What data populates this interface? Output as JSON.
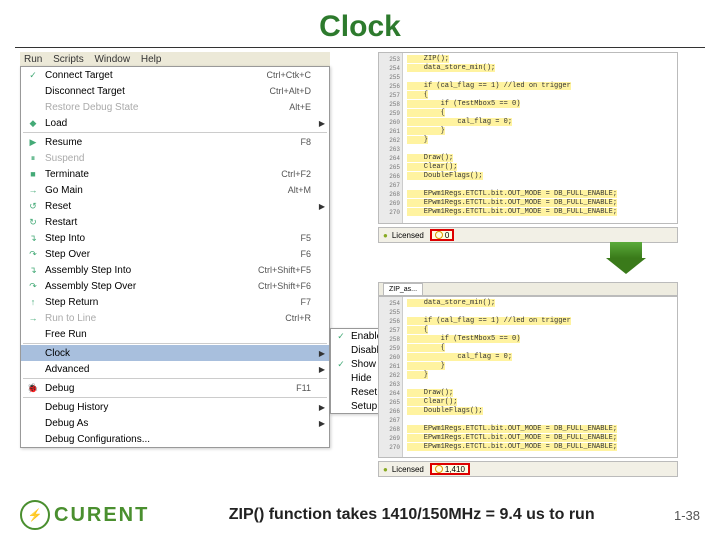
{
  "title": "Clock",
  "menubar": {
    "items": [
      "Run",
      "Scripts",
      "Window",
      "Help"
    ]
  },
  "menu": {
    "items": [
      {
        "icon": "✓",
        "label": "Connect Target",
        "shortcut": "Ctrl+Ctk+C",
        "arrow": false
      },
      {
        "icon": "",
        "label": "Disconnect Target",
        "shortcut": "Ctrl+Alt+D",
        "arrow": false
      },
      {
        "icon": "",
        "label": "Restore Debug State",
        "shortcut": "Alt+E",
        "arrow": false,
        "disabled": true
      },
      {
        "icon": "◆",
        "label": "Load",
        "shortcut": "",
        "arrow": true
      },
      {
        "sep": true
      },
      {
        "icon": "▶",
        "label": "Resume",
        "shortcut": "F8",
        "arrow": false
      },
      {
        "icon": "⏸",
        "label": "Suspend",
        "shortcut": "",
        "arrow": false,
        "disabled": true
      },
      {
        "icon": "■",
        "label": "Terminate",
        "shortcut": "Ctrl+F2",
        "arrow": false
      },
      {
        "icon": "→",
        "label": "Go Main",
        "shortcut": "Alt+M",
        "arrow": false
      },
      {
        "icon": "↺",
        "label": "Reset",
        "shortcut": "",
        "arrow": true
      },
      {
        "icon": "↻",
        "label": "Restart",
        "shortcut": "",
        "arrow": false
      },
      {
        "icon": "↴",
        "label": "Step Into",
        "shortcut": "F5",
        "arrow": false
      },
      {
        "icon": "↷",
        "label": "Step Over",
        "shortcut": "F6",
        "arrow": false
      },
      {
        "icon": "↴",
        "label": "Assembly Step Into",
        "shortcut": "Ctrl+Shift+F5",
        "arrow": false
      },
      {
        "icon": "↷",
        "label": "Assembly Step Over",
        "shortcut": "Ctrl+Shift+F6",
        "arrow": false
      },
      {
        "icon": "↑",
        "label": "Step Return",
        "shortcut": "F7",
        "arrow": false
      },
      {
        "icon": "→",
        "label": "Run to Line",
        "shortcut": "Ctrl+R",
        "arrow": false,
        "disabled": true
      },
      {
        "icon": "",
        "label": "Free Run",
        "shortcut": "",
        "arrow": false
      },
      {
        "sep": true
      },
      {
        "icon": "",
        "label": "Clock",
        "shortcut": "",
        "arrow": true,
        "sel": true
      },
      {
        "icon": "",
        "label": "Advanced",
        "shortcut": "",
        "arrow": true
      },
      {
        "sep": true
      },
      {
        "icon": "🐞",
        "label": "Debug",
        "shortcut": "F11",
        "arrow": false
      },
      {
        "sep": true
      },
      {
        "icon": "",
        "label": "Debug History",
        "shortcut": "",
        "arrow": true
      },
      {
        "icon": "",
        "label": "Debug As",
        "shortcut": "",
        "arrow": true
      },
      {
        "icon": "",
        "label": "Debug Configurations...",
        "shortcut": "",
        "arrow": false
      }
    ]
  },
  "submenu": {
    "items": [
      {
        "check": true,
        "label": "Enable"
      },
      {
        "check": false,
        "label": "Disable"
      },
      {
        "check": true,
        "label": "Show"
      },
      {
        "check": false,
        "label": "Hide"
      },
      {
        "check": false,
        "label": "Reset"
      },
      {
        "check": false,
        "label": "Setup..."
      }
    ]
  },
  "code_top": {
    "lines": [
      "253",
      "254",
      "255",
      "256",
      "257",
      "258",
      "259",
      "260",
      "261",
      "262",
      "263",
      "264",
      "265",
      "266",
      "267",
      "268",
      "269",
      "270"
    ],
    "src": "    ZIP();\n    data_store_min();\n\n    if (cal_flag == 1) //led on trigger\n    {\n        if (TestMbox5 == 0)\n        {\n            cal_flag = 0;\n        }\n    }\n\n    Draw();\n    Clear();\n    DoubleFlags();\n\n    EPwm1Regs.ETCTL.bit.OUT_MODE = DB_FULL_ENABLE;\n    EPwm1Regs.ETCTL.bit.OUT_MODE = DB_FULL_ENABLE;\n    EPwm1Regs.ETCTL.bit.OUT_MODE = DB_FULL_ENABLE;"
  },
  "code_bot": {
    "lines": [
      "254",
      "255",
      "256",
      "257",
      "258",
      "259",
      "260",
      "261",
      "262",
      "263",
      "264",
      "265",
      "266",
      "267",
      "268",
      "269",
      "270"
    ],
    "src": "    data_store_min();\n\n    if (cal_flag == 1) //led on trigger\n    {\n        if (TestMbox5 == 0)\n        {\n            cal_flag = 0;\n        }\n    }\n\n    Draw();\n    Clear();\n    DoubleFlags();\n\n    EPwm1Regs.ETCTL.bit.OUT_MODE = DB_FULL_ENABLE;\n    EPwm1Regs.ETCTL.bit.OUT_MODE = DB_FULL_ENABLE;\n    EPwm1Regs.ETCTL.bit.OUT_MODE = DB_FULL_ENABLE;"
  },
  "tab_top": {
    "label": "ZIP_as..."
  },
  "status_top": {
    "left": "Licensed",
    "clock": "0"
  },
  "status_bot": {
    "left": "Licensed",
    "clock": "1,410"
  },
  "logo": {
    "text": "CURENT"
  },
  "caption": "ZIP() function takes 1410/150MHz = 9.4 us to run",
  "pagenum": "1-38"
}
